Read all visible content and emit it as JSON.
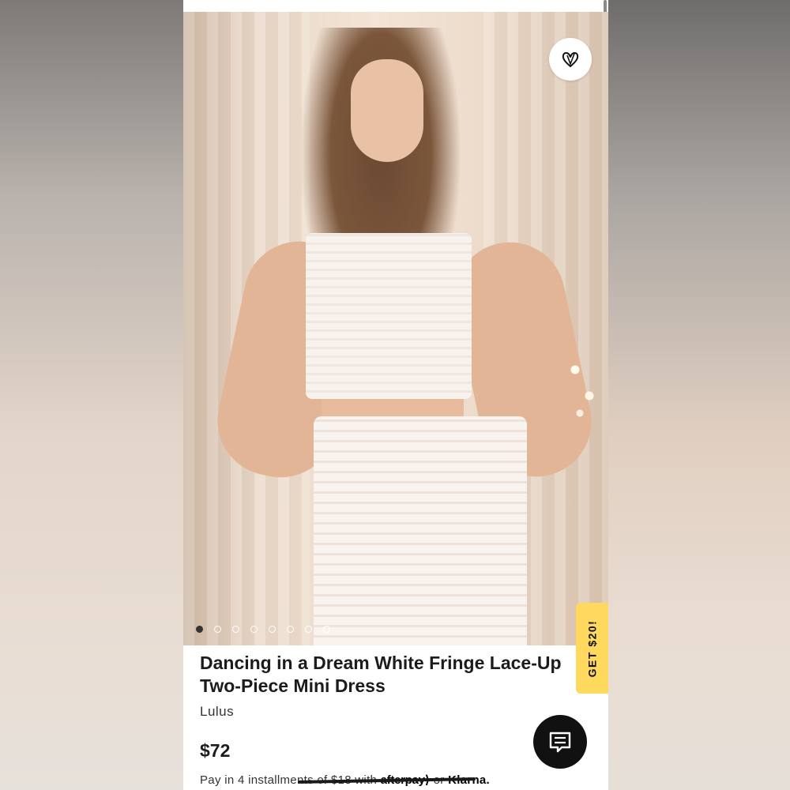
{
  "product": {
    "title": "Dancing in a Dream White Fringe Lace-Up Two-Piece Mini Dress",
    "brand": "Lulus",
    "price": "$72"
  },
  "payment": {
    "text_prefix": "Pay in 4 installments of $18 with",
    "afterpay_label": "afterpay",
    "or_text": "or",
    "klarna_label": "Klarna."
  },
  "promo": {
    "label": "GET $20!",
    "color": "#ffd95e"
  },
  "carousel": {
    "total_images": 8,
    "active_index": 0
  },
  "icons": {
    "favorite": "heart-icon",
    "chat": "chat-bubble-icon"
  }
}
